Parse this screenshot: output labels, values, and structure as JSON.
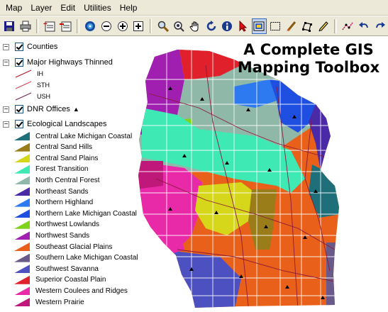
{
  "menu": [
    "Map",
    "Layer",
    "Edit",
    "Utilities",
    "Help"
  ],
  "toolbar_icons": [
    "save-icon",
    "print-icon",
    "add-layer-icon",
    "remove-layer-icon",
    "full-extent-icon",
    "zoom-out-icon",
    "zoom-in-icon",
    "zoom-box-icon",
    "magnify-icon",
    "zoom-glass-icon",
    "pan-hand-icon",
    "refresh-icon",
    "identify-icon",
    "select-arrow-icon",
    "select-feature-icon",
    "select-rect-icon",
    "draw-brush-icon",
    "polygon-icon",
    "pencil-icon",
    "measure-icon",
    "undo-icon",
    "redo-icon"
  ],
  "toc": {
    "layers": [
      {
        "label": "Counties",
        "expander": "−"
      },
      {
        "label": "Major Highways Thinned",
        "expander": "−"
      },
      {
        "label": "DNR Offices",
        "expander": "−"
      },
      {
        "label": "Ecological Landscapes",
        "expander": "−"
      }
    ],
    "highway_classes": [
      {
        "label": "IH",
        "color": "#b01020"
      },
      {
        "label": "STH",
        "color": "#d04050"
      },
      {
        "label": "USH",
        "color": "#702050"
      }
    ],
    "dnr_marker": "▲",
    "landscapes": [
      {
        "label": "Central Lake Michigan Coastal",
        "color": "#1f6f7a"
      },
      {
        "label": "Central Sand Hills",
        "color": "#9a7d18"
      },
      {
        "label": "Central Sand Plains",
        "color": "#d6d61a"
      },
      {
        "label": "Forest Transition",
        "color": "#3fe9b3"
      },
      {
        "label": "North Central Forest",
        "color": "#8fb8a8"
      },
      {
        "label": "Northeast Sands",
        "color": "#4a2aa6"
      },
      {
        "label": "Northern Highland",
        "color": "#2d7af0"
      },
      {
        "label": "Northern Lake Michigan Coastal",
        "color": "#1f4fe0"
      },
      {
        "label": "Northwest Lowlands",
        "color": "#7fd31a"
      },
      {
        "label": "Northwest Sands",
        "color": "#a01fb0"
      },
      {
        "label": "Southeast Glacial Plains",
        "color": "#e8601a"
      },
      {
        "label": "Southern Lake Michigan Coastal",
        "color": "#6a5a8a"
      },
      {
        "label": "Southwest Savanna",
        "color": "#4d50c0"
      },
      {
        "label": "Superior Coastal Plain",
        "color": "#e0202a"
      },
      {
        "label": "Western Coulees and Ridges",
        "color": "#e82aa8"
      },
      {
        "label": "Western Prairie",
        "color": "#c0187a"
      }
    ]
  },
  "map_title": {
    "line1": "A Complete GIS",
    "line2": "Mapping Toolbox"
  }
}
